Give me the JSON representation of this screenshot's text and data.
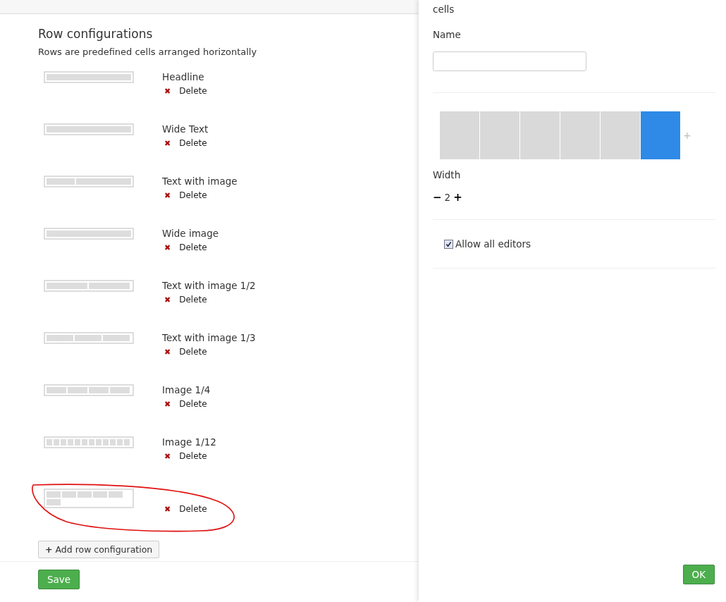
{
  "main": {
    "title": "Row configurations",
    "subtitle": "Rows are predefined cells arranged horizontally",
    "rows": [
      {
        "name": "Headline",
        "kind": "full",
        "delete_icon": "✖",
        "delete_label": "Delete"
      },
      {
        "name": "Wide Text",
        "kind": "full",
        "delete_icon": "✖",
        "delete_label": "Delete"
      },
      {
        "name": "Text with image",
        "kind": "split",
        "delete_icon": "✖",
        "delete_label": "Delete"
      },
      {
        "name": "Wide image",
        "kind": "full",
        "delete_icon": "✖",
        "delete_label": "Delete"
      },
      {
        "name": "Text with image 1/2",
        "kind": "halves",
        "delete_icon": "✖",
        "delete_label": "Delete"
      },
      {
        "name": "Text with image 1/3",
        "kind": "thirds",
        "delete_icon": "✖",
        "delete_label": "Delete"
      },
      {
        "name": "Image 1/4",
        "kind": "quarters",
        "delete_icon": "✖",
        "delete_label": "Delete"
      },
      {
        "name": "Image 1/12",
        "kind": "twelfths",
        "delete_icon": "✖",
        "delete_label": "Delete"
      },
      {
        "kind": "sixths",
        "delete_icon": "✖",
        "delete_label": "Delete"
      }
    ],
    "add_button": {
      "icon": "+",
      "label": "Add row configuration"
    },
    "save_button": "Save"
  },
  "editor": {
    "intro": "cells",
    "name_label": "Name",
    "cells": [
      {
        "selected": false
      },
      {
        "selected": false
      },
      {
        "selected": false
      },
      {
        "selected": false
      },
      {
        "selected": false
      },
      {
        "selected": true
      }
    ],
    "add_cell": "+",
    "width_label": "Width",
    "decrease": "−",
    "width_value": "2",
    "increase": "+",
    "allow_all_editors": {
      "label": "Allow all editors",
      "checked": true
    },
    "ok_button": "OK"
  }
}
